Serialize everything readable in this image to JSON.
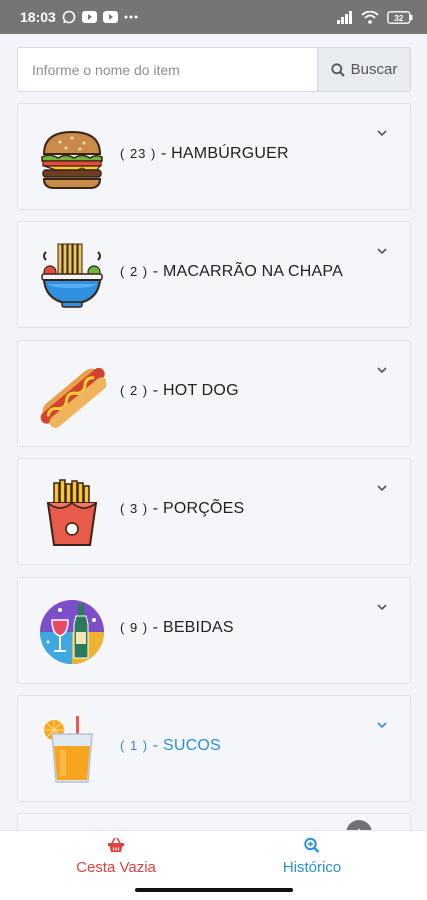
{
  "status_bar": {
    "time": "18:03",
    "battery": "32",
    "icons": [
      "whatsapp-icon",
      "youtube-icon",
      "youtube-icon",
      "more-dots-icon",
      "signal-icon",
      "wifi-icon",
      "battery-icon"
    ]
  },
  "search": {
    "placeholder": "Informe o nome do item",
    "value": "",
    "button_label": "Buscar",
    "button_icon": "search-icon"
  },
  "categories": [
    {
      "count": "( 23 )",
      "name": " - HAMBÚRGUER",
      "icon": "hamburger-icon",
      "active": false
    },
    {
      "count": "( 2 )",
      "name": " - MACARRÃO NA CHAPA",
      "icon": "noodle-bowl-icon",
      "active": false
    },
    {
      "count": "( 2 )",
      "name": " - HOT DOG",
      "icon": "hot-dog-icon",
      "active": false
    },
    {
      "count": "( 3 )",
      "name": " - PORÇÕES",
      "icon": "fries-icon",
      "active": false
    },
    {
      "count": "( 9 )",
      "name": " - BEBIDAS",
      "icon": "drinks-icon",
      "active": false
    },
    {
      "count": "( 1 )",
      "name": " - SUCOS",
      "icon": "juice-icon",
      "active": true
    }
  ],
  "bottom_nav": {
    "cesta": {
      "label": "Cesta Vazia",
      "icon": "basket-icon",
      "color": "#e4413c"
    },
    "historico": {
      "label": "Histórico",
      "icon": "zoom-history-icon",
      "color": "#2b8fd6"
    }
  },
  "colors": {
    "accent_blue": "#2b8fd6",
    "accent_red": "#e4413c",
    "status_bar": "#757575"
  }
}
